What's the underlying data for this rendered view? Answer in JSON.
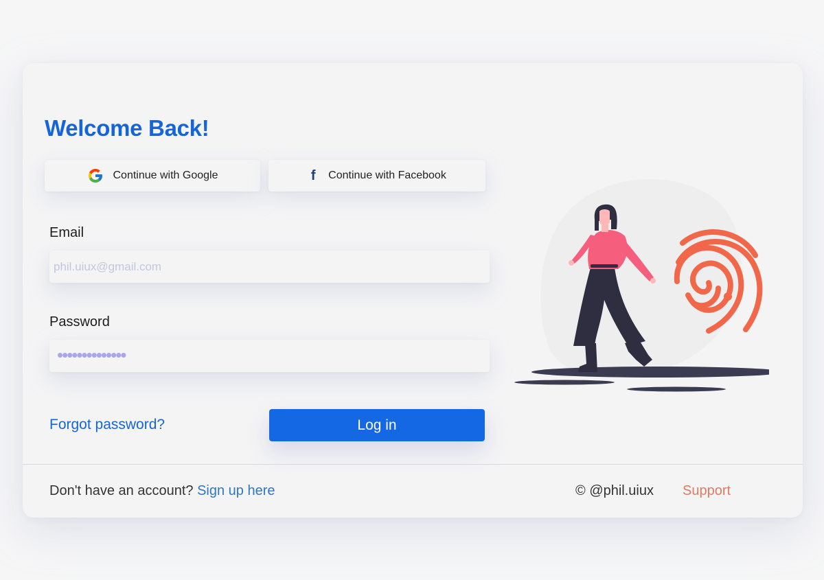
{
  "login": {
    "title": "Welcome Back!",
    "social": {
      "google_label": "Continue with Google",
      "facebook_label": "Continue with Facebook",
      "google_icon": "google-g-icon",
      "facebook_icon": "facebook-f-icon",
      "facebook_glyph": "f"
    },
    "email": {
      "label": "Email",
      "placeholder": "phil.uiux@gmail.com",
      "value": ""
    },
    "password": {
      "label": "Password",
      "masked_value": "••••••••••••••"
    },
    "forgot_label": "Forgot password?",
    "login_label": "Log in"
  },
  "footer": {
    "signup_prompt": "Don't have an account?",
    "signup_link": "Sign up here",
    "copyright": "© @phil.uiux",
    "support": "Support"
  },
  "illustration": {
    "name": "woman-with-fingerprint-illustration"
  },
  "colors": {
    "accent": "#1565d8",
    "button": "#1468e4",
    "support": "#e07a60",
    "fingerprint": "#f1674a",
    "background": "#f4f4f5"
  }
}
